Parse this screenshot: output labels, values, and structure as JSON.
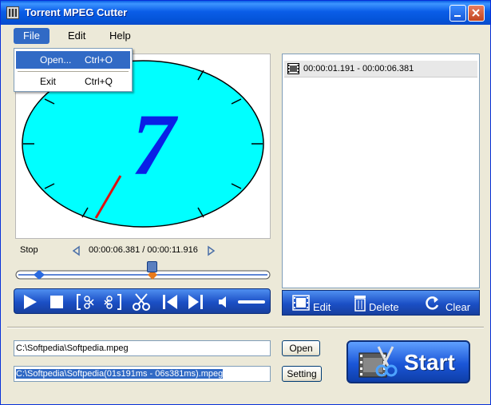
{
  "window": {
    "title": "Torrent MPEG Cutter"
  },
  "menubar": {
    "file": "File",
    "edit": "Edit",
    "help": "Help"
  },
  "file_menu": {
    "open": {
      "label": "Open...",
      "shortcut": "Ctrl+O"
    },
    "exit": {
      "label": "Exit",
      "shortcut": "Ctrl+Q"
    }
  },
  "player": {
    "clock_digit": "7",
    "status": "Stop",
    "time_display": "00:00:06.381 / 00:00:11.916",
    "position_fraction": 0.535
  },
  "segments": {
    "items": [
      "00:00:01.191 - 00:00:06.381"
    ],
    "edit_label": "Edit",
    "delete_label": "Delete",
    "clear_label": "Clear"
  },
  "files": {
    "input_path": "C:\\Softpedia\\Softpedia.mpeg",
    "output_path": "C:\\Softpedia\\Softpedia(01s191ms - 06s381ms).mpeg",
    "open_label": "Open",
    "setting_label": "Setting",
    "start_label": "Start"
  },
  "colors": {
    "accent": "#316ac5",
    "clock_face": "#00ffff",
    "digit": "#0a1fe6",
    "hand": "#e01010",
    "mark_in": "#2a6ae0",
    "mark_out": "#e87a1a"
  }
}
